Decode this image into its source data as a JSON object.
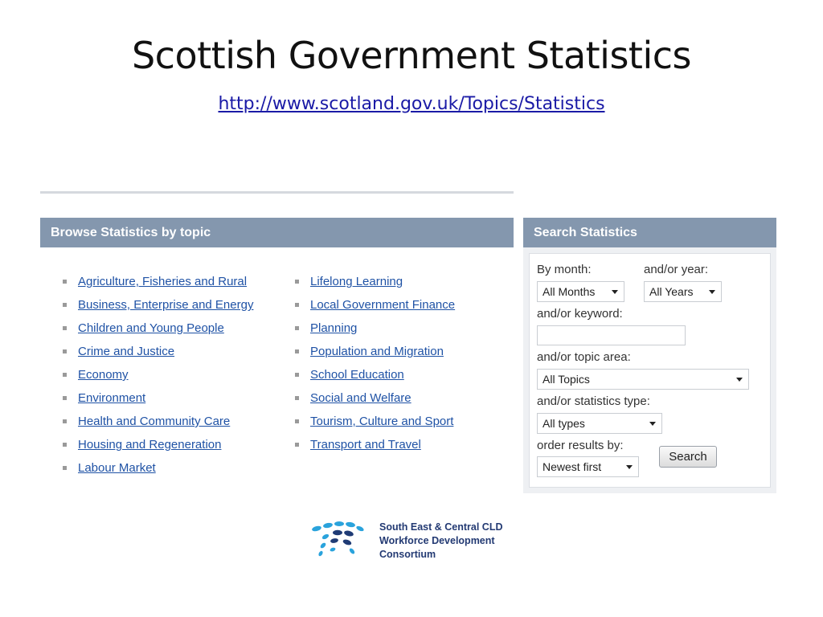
{
  "slide": {
    "title": "Scottish Government Statistics",
    "url": "http://www.scotland.gov.uk/Topics/Statistics"
  },
  "browse": {
    "header": "Browse Statistics by topic",
    "left_topics": [
      "Agriculture, Fisheries and Rural",
      "Business, Enterprise and Energy",
      "Children and Young People",
      "Crime and Justice",
      "Economy",
      "Environment",
      "Health and Community Care",
      "Housing and Regeneration",
      "Labour Market"
    ],
    "right_topics": [
      "Lifelong Learning",
      "Local Government Finance",
      "Planning",
      "Population and Migration",
      "School Education",
      "Social and Welfare",
      "Tourism, Culture and Sport",
      "Transport and Travel"
    ]
  },
  "search": {
    "header": "Search Statistics",
    "month_label": "By month:",
    "month_value": "All Months",
    "year_label": "and/or year:",
    "year_value": "All Years",
    "keyword_label": "and/or keyword:",
    "keyword_value": "",
    "topic_label": "and/or topic area:",
    "topic_value": "All Topics",
    "type_label": "and/or statistics type:",
    "type_value": "All types",
    "order_label": "order results by:",
    "order_value": "Newest first",
    "search_button": "Search"
  },
  "logo": {
    "line1": "South East & Central CLD",
    "line2": "Workforce Development",
    "line3": "Consortium",
    "colors": {
      "light": "#2aa3dc",
      "dark": "#1f3b75"
    }
  }
}
